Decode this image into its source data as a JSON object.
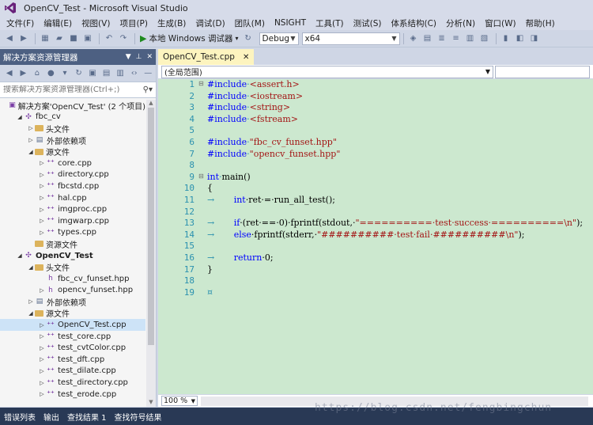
{
  "window": {
    "title": "OpenCV_Test - Microsoft Visual Studio"
  },
  "menu": [
    "文件(F)",
    "编辑(E)",
    "视图(V)",
    "项目(P)",
    "生成(B)",
    "调试(D)",
    "团队(M)",
    "NSIGHT",
    "工具(T)",
    "测试(S)",
    "体系结构(C)",
    "分析(N)",
    "窗口(W)",
    "帮助(H)"
  ],
  "toolbar": {
    "run_label": "本地 Windows 调试器",
    "config": "Debug",
    "platform": "x64"
  },
  "solution_explorer": {
    "title": "解决方案资源管理器",
    "search_placeholder": "搜索解决方案资源管理器(Ctrl+;)",
    "items": [
      {
        "label": "解决方案'OpenCV_Test' (2 个项目)",
        "indent": 0,
        "icon": "sol",
        "exp": ""
      },
      {
        "label": "fbc_cv",
        "indent": 1,
        "icon": "proj",
        "exp": "◢"
      },
      {
        "label": "头文件",
        "indent": 2,
        "icon": "folder",
        "exp": "▷"
      },
      {
        "label": "外部依赖项",
        "indent": 2,
        "icon": "dep",
        "exp": "▷"
      },
      {
        "label": "源文件",
        "indent": 2,
        "icon": "folder",
        "exp": "◢"
      },
      {
        "label": "core.cpp",
        "indent": 3,
        "icon": "cpp",
        "exp": "▷"
      },
      {
        "label": "directory.cpp",
        "indent": 3,
        "icon": "cpp",
        "exp": "▷"
      },
      {
        "label": "fbcstd.cpp",
        "indent": 3,
        "icon": "cpp",
        "exp": "▷"
      },
      {
        "label": "hal.cpp",
        "indent": 3,
        "icon": "cpp",
        "exp": "▷"
      },
      {
        "label": "imgproc.cpp",
        "indent": 3,
        "icon": "cpp",
        "exp": "▷"
      },
      {
        "label": "imgwarp.cpp",
        "indent": 3,
        "icon": "cpp",
        "exp": "▷"
      },
      {
        "label": "types.cpp",
        "indent": 3,
        "icon": "cpp",
        "exp": "▷"
      },
      {
        "label": "资源文件",
        "indent": 2,
        "icon": "folder",
        "exp": ""
      },
      {
        "label": "OpenCV_Test",
        "indent": 1,
        "icon": "proj",
        "exp": "◢",
        "bold": true
      },
      {
        "label": "头文件",
        "indent": 2,
        "icon": "folder",
        "exp": "◢"
      },
      {
        "label": "fbc_cv_funset.hpp",
        "indent": 3,
        "icon": "hpp",
        "exp": ""
      },
      {
        "label": "opencv_funset.hpp",
        "indent": 3,
        "icon": "hpp",
        "exp": "▷"
      },
      {
        "label": "外部依赖项",
        "indent": 2,
        "icon": "dep",
        "exp": "▷"
      },
      {
        "label": "源文件",
        "indent": 2,
        "icon": "folder",
        "exp": "◢"
      },
      {
        "label": "OpenCV_Test.cpp",
        "indent": 3,
        "icon": "cpp",
        "exp": "▷",
        "selected": true
      },
      {
        "label": "test_core.cpp",
        "indent": 3,
        "icon": "cpp",
        "exp": "▷"
      },
      {
        "label": "test_cvtColor.cpp",
        "indent": 3,
        "icon": "cpp",
        "exp": "▷"
      },
      {
        "label": "test_dft.cpp",
        "indent": 3,
        "icon": "cpp",
        "exp": "▷"
      },
      {
        "label": "test_dilate.cpp",
        "indent": 3,
        "icon": "cpp",
        "exp": "▷"
      },
      {
        "label": "test_directory.cpp",
        "indent": 3,
        "icon": "cpp",
        "exp": "▷"
      },
      {
        "label": "test_erode.cpp",
        "indent": 3,
        "icon": "cpp",
        "exp": "▷"
      }
    ]
  },
  "editor": {
    "tab_label": "OpenCV_Test.cpp",
    "scope": "(全局范围)",
    "zoom": "100 %",
    "line_numbers": [
      "1",
      "2",
      "3",
      "4",
      "5",
      "6",
      "7",
      "8",
      "9",
      "10",
      "11",
      "12",
      "13",
      "14",
      "15",
      "16",
      "17",
      "18",
      "19"
    ],
    "code": [
      [
        {
          "t": "#include",
          "c": "pp"
        },
        {
          "t": "·",
          "c": "ws"
        },
        {
          "t": "<assert.h>",
          "c": "inc"
        }
      ],
      [
        {
          "t": "#include",
          "c": "pp"
        },
        {
          "t": "·",
          "c": "ws"
        },
        {
          "t": "<iostream>",
          "c": "inc"
        }
      ],
      [
        {
          "t": "#include",
          "c": "pp"
        },
        {
          "t": "·",
          "c": "ws"
        },
        {
          "t": "<string>",
          "c": "inc"
        }
      ],
      [
        {
          "t": "#include",
          "c": "pp"
        },
        {
          "t": "·",
          "c": "ws"
        },
        {
          "t": "<fstream>",
          "c": "inc"
        }
      ],
      [],
      [
        {
          "t": "#include",
          "c": "pp"
        },
        {
          "t": "·",
          "c": "ws"
        },
        {
          "t": "\"fbc_cv_funset.hpp\"",
          "c": "inc"
        }
      ],
      [
        {
          "t": "#include",
          "c": "pp"
        },
        {
          "t": "·",
          "c": "ws"
        },
        {
          "t": "\"opencv_funset.hpp\"",
          "c": "inc"
        }
      ],
      [],
      [
        {
          "t": "int",
          "c": "kw"
        },
        {
          "t": "·",
          "c": "ws"
        },
        {
          "t": "main()",
          "c": ""
        }
      ],
      [
        {
          "t": "{",
          "c": ""
        }
      ],
      [
        {
          "t": "→",
          "c": "ws"
        },
        {
          "t": "       ",
          "c": ""
        },
        {
          "t": "int",
          "c": "kw"
        },
        {
          "t": "·ret·=·run_all_test();",
          "c": ""
        }
      ],
      [],
      [
        {
          "t": "→",
          "c": "ws"
        },
        {
          "t": "       ",
          "c": ""
        },
        {
          "t": "if",
          "c": "kw"
        },
        {
          "t": "·(ret·==·0)·fprintf(stdout,·",
          "c": ""
        },
        {
          "t": "\"==========·test·success·==========\\n\"",
          "c": "str"
        },
        {
          "t": ");",
          "c": ""
        }
      ],
      [
        {
          "t": "→",
          "c": "ws"
        },
        {
          "t": "       ",
          "c": ""
        },
        {
          "t": "else",
          "c": "kw"
        },
        {
          "t": "·fprintf(stderr,·",
          "c": ""
        },
        {
          "t": "\"##########·test·fail·##########\\n\"",
          "c": "str"
        },
        {
          "t": ");",
          "c": ""
        }
      ],
      [],
      [
        {
          "t": "→",
          "c": "ws"
        },
        {
          "t": "       ",
          "c": ""
        },
        {
          "t": "return",
          "c": "kw"
        },
        {
          "t": "·0;",
          "c": ""
        }
      ],
      [
        {
          "t": "}",
          "c": ""
        }
      ],
      [],
      [
        {
          "t": "¤",
          "c": "ws"
        }
      ]
    ]
  },
  "bottom_tabs": [
    "错误列表",
    "输出",
    "查找结果 1",
    "查找符号结果"
  ],
  "watermark": "https://blog.csdn.net/fengbingchun"
}
